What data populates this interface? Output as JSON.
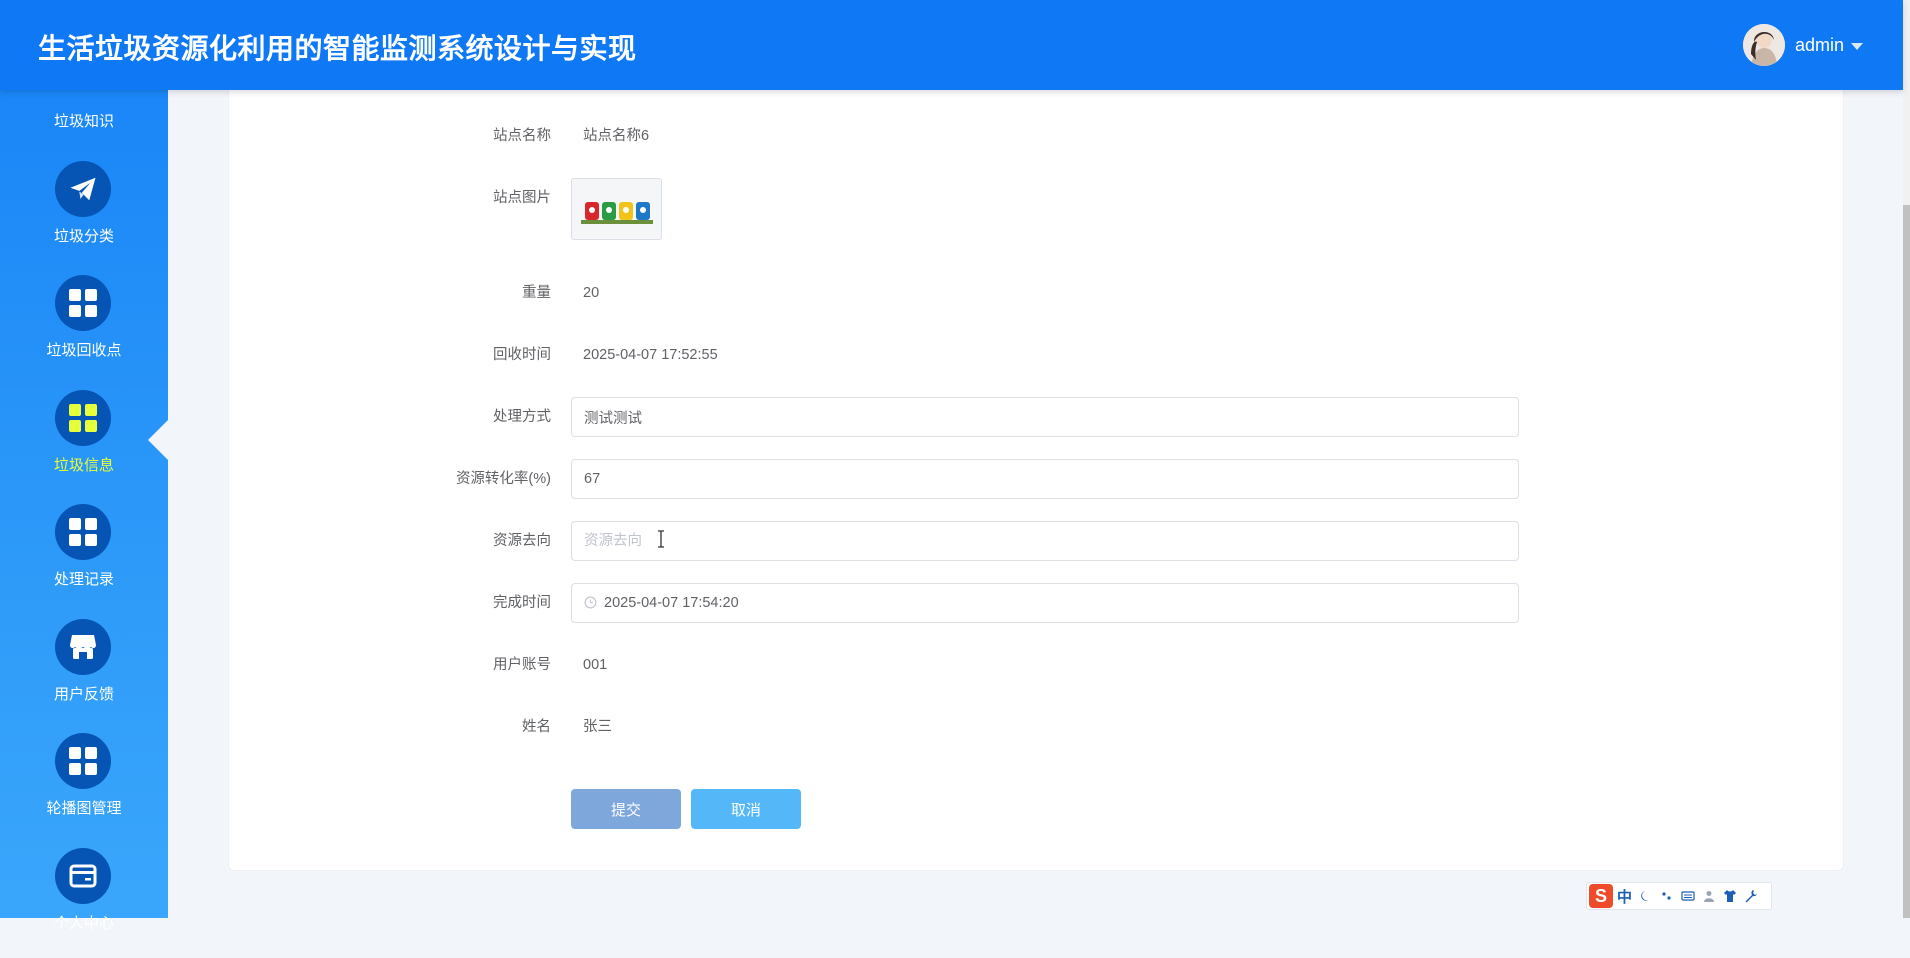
{
  "header": {
    "title": "生活垃圾资源化利用的智能监测系统设计与实现",
    "username": "admin"
  },
  "sidebar": {
    "top_label": "垃圾知识",
    "items": [
      {
        "label": "垃圾分类",
        "icon": "paper-plane-icon",
        "active": false
      },
      {
        "label": "垃圾回收点",
        "icon": "grid-icon",
        "active": false
      },
      {
        "label": "垃圾信息",
        "icon": "grid-icon",
        "active": true
      },
      {
        "label": "处理记录",
        "icon": "grid-icon",
        "active": false
      },
      {
        "label": "用户反馈",
        "icon": "storefront-icon",
        "active": false
      },
      {
        "label": "轮播图管理",
        "icon": "grid-icon",
        "active": false
      },
      {
        "label": "个人中心",
        "icon": "wallet-card-icon",
        "active": false
      }
    ],
    "active_color": "#e7ff3b"
  },
  "form": {
    "station_name": {
      "label": "站点名称",
      "value": "站点名称6"
    },
    "station_image": {
      "label": "站点图片"
    },
    "weight": {
      "label": "重量",
      "value": "20"
    },
    "recycle_time": {
      "label": "回收时间",
      "value": "2025-04-07 17:52:55"
    },
    "process_method": {
      "label": "处理方式",
      "value": "测试测试"
    },
    "conversion_rate": {
      "label": "资源转化率(%)",
      "value": "67"
    },
    "destination": {
      "label": "资源去向",
      "value": "",
      "placeholder": "资源去向"
    },
    "finish_time": {
      "label": "完成时间",
      "value": "2025-04-07 17:54:20"
    },
    "user_account": {
      "label": "用户账号",
      "value": "001"
    },
    "name": {
      "label": "姓名",
      "value": "张三"
    },
    "submit_label": "提交",
    "cancel_label": "取消"
  },
  "ime": {
    "logo": "S",
    "mode": "中"
  },
  "colors": {
    "header_bg": "#0e78f5",
    "submit_bg": "#7ea7dc",
    "cancel_bg": "#54b7f8"
  }
}
